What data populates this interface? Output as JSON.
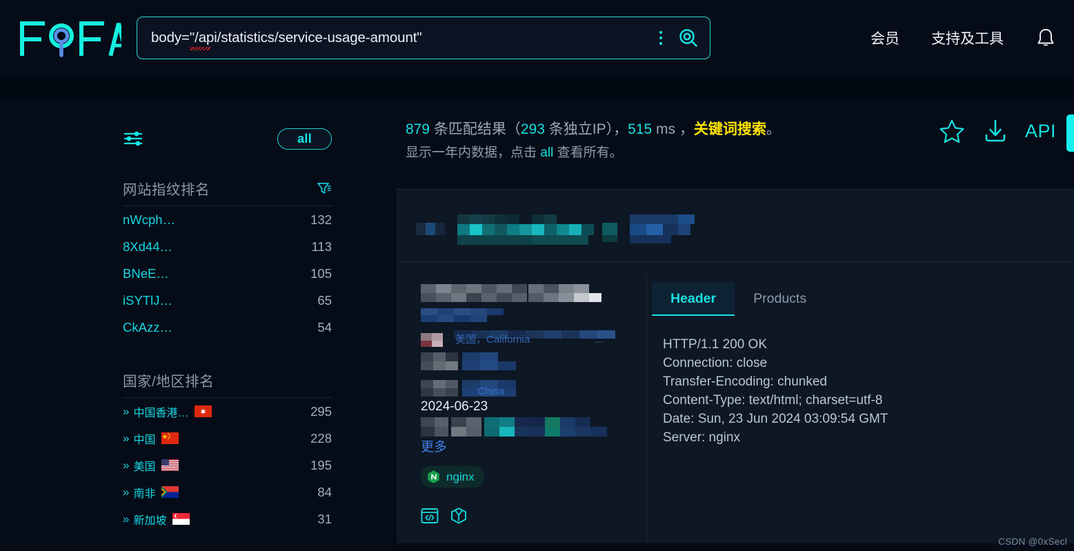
{
  "brand": {
    "name": "FOFA"
  },
  "search": {
    "query": "body=\"/api/statistics/service-usage-amount\"",
    "placeholder": "",
    "menu_icon": "vertical-dots-icon",
    "submit_icon": "search-magnifier-icon"
  },
  "header_nav": {
    "member": "会员",
    "support": "支持及工具",
    "bell_icon": "notification-bell-icon"
  },
  "sidebar": {
    "filter_toggle_icon": "sliders-icon",
    "all_button": "all",
    "sections": [
      {
        "title": "网站指纹排名",
        "filter_icon": "funnel-filter-icon",
        "rows": [
          {
            "label": "nWcph…",
            "count": "132"
          },
          {
            "label": "8Xd44…",
            "count": "113"
          },
          {
            "label": "BNeE…",
            "count": "105"
          },
          {
            "label": "iSYTlJ…",
            "count": "65"
          },
          {
            "label": "CkAzz…",
            "count": "54"
          }
        ]
      },
      {
        "title": "国家/地区排名",
        "rows": [
          {
            "label": "中国香港…",
            "count": "295",
            "flag": "hk"
          },
          {
            "label": "中国",
            "count": "228",
            "flag": "cn"
          },
          {
            "label": "美国",
            "count": "195",
            "flag": "us"
          },
          {
            "label": "南非",
            "count": "84",
            "flag": "za"
          },
          {
            "label": "新加坡",
            "count": "31",
            "flag": "sg"
          }
        ]
      }
    ]
  },
  "summary": {
    "matches": "879",
    "matches_suffix": " 条匹配结果（",
    "unique_ip": "293",
    "unique_ip_suffix": " 条独立IP），",
    "latency": "515",
    "latency_unit": " ms ，",
    "search_type": "关键词搜索",
    "period_pre": "显示一年内数据，点击 ",
    "period_link": "all",
    "period_post": " 查看所有。"
  },
  "actions": {
    "favorite_icon": "star-favorite-icon",
    "download_icon": "download-icon",
    "api_label": "API",
    "edge_tab": "side-panel-handle"
  },
  "result": {
    "date": "2024-06-23",
    "more_label": "更多",
    "tabs": [
      {
        "label": "Header",
        "active": true
      },
      {
        "label": "Products",
        "active": false
      }
    ],
    "header_body": "HTTP/1.1 200 OK\nConnection: close\nTransfer-Encoding: chunked\nContent-Type: text/html; charset=utf-8\nDate: Sun, 23 Jun 2024 03:09:54 GMT\nServer: nginx",
    "product_tag": "nginx",
    "product_tag_icon": "nginx-hexagon-logo",
    "footer_icons": [
      {
        "name": "view-source-code-icon"
      },
      {
        "name": "cube-3d-icon"
      }
    ]
  },
  "watermark": "CSDN @0xSecl",
  "colors": {
    "accent_cyan": "#19e0e0",
    "highlight_yellow": "#ffe400",
    "page_bg": "#050c18",
    "card_bg": "#0e1724",
    "link_blue": "#3f7fe8"
  }
}
